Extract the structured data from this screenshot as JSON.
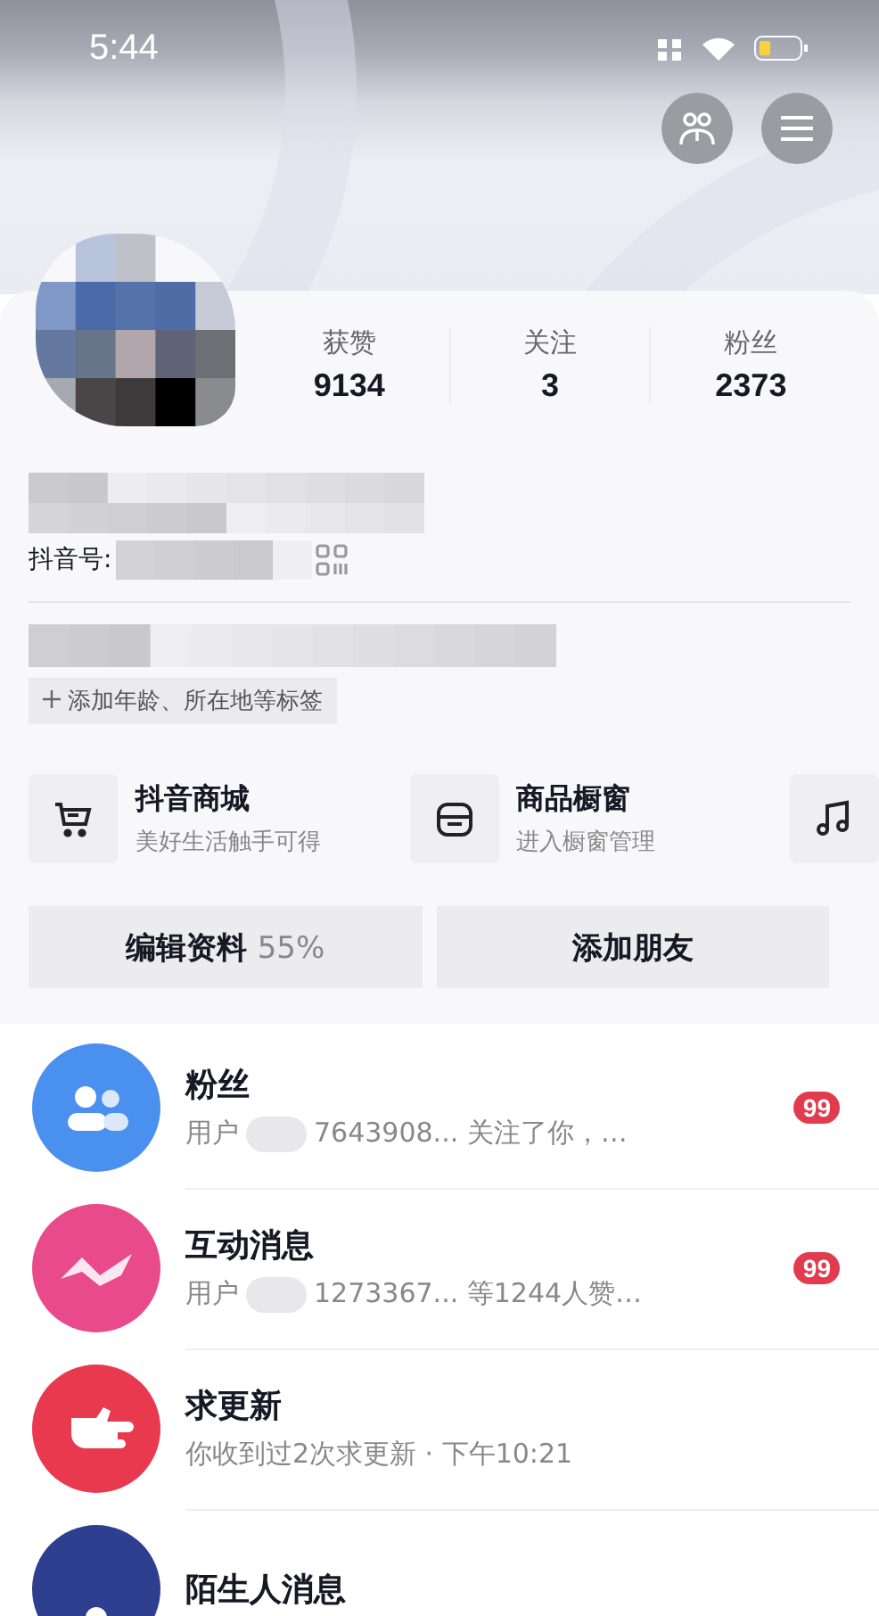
{
  "status_bar": {
    "time": "5:44"
  },
  "stats": [
    {
      "label": "获赞",
      "value": "9134"
    },
    {
      "label": "关注",
      "value": "3"
    },
    {
      "label": "粉丝",
      "value": "2373"
    }
  ],
  "profile": {
    "id_label": "抖音号:",
    "tag_button": "添加年龄、所在地等标签"
  },
  "shortcuts": [
    {
      "kind": "cart",
      "title": "抖音商城",
      "subtitle": "美好生活触手可得"
    },
    {
      "kind": "store",
      "title": "商品橱窗",
      "subtitle": "进入橱窗管理"
    },
    {
      "kind": "music"
    }
  ],
  "buttons": [
    {
      "label": "编辑资料",
      "extra": "55%"
    },
    {
      "label": "添加朋友"
    }
  ],
  "messages": [
    {
      "kind": "people",
      "color": "#4a90ee",
      "title": "粉丝",
      "prefix": "用户",
      "subtitle": "7643908... 关注了你，…",
      "badge": "99"
    },
    {
      "kind": "wave",
      "color": "#e84a8c",
      "title": "互动消息",
      "prefix": "用户",
      "subtitle": "1273367... 等1244人赞…",
      "badge": "99"
    },
    {
      "kind": "hand",
      "color": "#e8394f",
      "title": "求更新",
      "subtitle": "你收到过2次求更新 · 下午10:21"
    },
    {
      "kind": "person",
      "color": "#2f3f8f",
      "title": "陌生人消息"
    }
  ]
}
